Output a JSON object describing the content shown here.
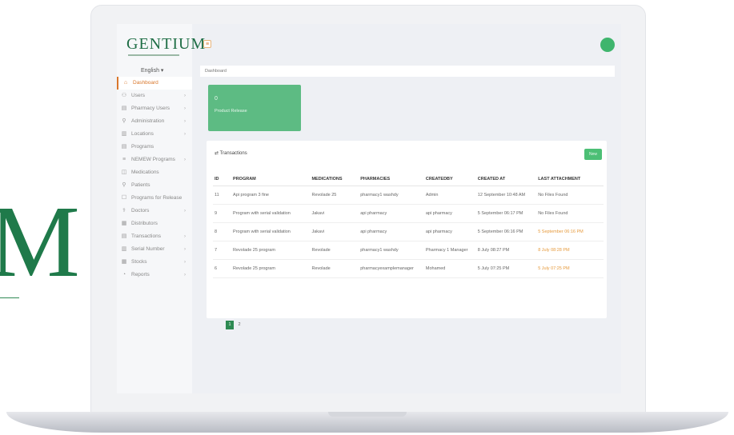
{
  "decor": {
    "letter": "M"
  },
  "sidebar": {
    "logo": "GENTIUM",
    "language": "English ▾",
    "items": [
      {
        "label": "Dashboard",
        "icon": "home-icon",
        "glyph": "⌂",
        "active": true
      },
      {
        "label": "Users",
        "icon": "user-icon",
        "glyph": "⚇",
        "chevron": "›"
      },
      {
        "label": "Pharmacy Users",
        "icon": "clipboard-icon",
        "glyph": "▤",
        "chevron": "›"
      },
      {
        "label": "Administration",
        "icon": "admin-icon",
        "glyph": "⚲",
        "chevron": "›"
      },
      {
        "label": "Locations",
        "icon": "location-icon",
        "glyph": "▥",
        "chevron": "›"
      },
      {
        "label": "Programs",
        "icon": "programs-icon",
        "glyph": "▤"
      },
      {
        "label": "NEMEW Programs",
        "icon": "list-icon",
        "glyph": "≡",
        "chevron": "›"
      },
      {
        "label": "Medications",
        "icon": "medication-icon",
        "glyph": "◫"
      },
      {
        "label": "Patients",
        "icon": "patient-icon",
        "glyph": "⚲"
      },
      {
        "label": "Programs for Release",
        "icon": "release-icon",
        "glyph": "☐"
      },
      {
        "label": "Doctors",
        "icon": "doctor-icon",
        "glyph": "⚕",
        "chevron": "›"
      },
      {
        "label": "Distributors",
        "icon": "distributor-icon",
        "glyph": "▦"
      },
      {
        "label": "Transactions",
        "icon": "transactions-icon",
        "glyph": "▤",
        "chevron": "›"
      },
      {
        "label": "Serial Number",
        "icon": "barcode-icon",
        "glyph": "▥",
        "chevron": "›"
      },
      {
        "label": "Stocks",
        "icon": "stocks-icon",
        "glyph": "▦",
        "chevron": "›"
      },
      {
        "label": "Reports",
        "icon": "reports-icon",
        "glyph": "◔",
        "chevron": "›"
      }
    ]
  },
  "topbar": {
    "menu_glyph": "≡"
  },
  "breadcrumb": "Dashboard",
  "product_card": {
    "number": "0",
    "label": "Product Release"
  },
  "transactions": {
    "title": "Transactions",
    "new_label": "New",
    "columns": [
      "ID",
      "PROGRAM",
      "MEDICATIONS",
      "PHARMACIES",
      "CREATEDBY",
      "CREATED AT",
      "LAST ATTACHMENT"
    ],
    "rows": [
      [
        "11",
        "Api program 3 fine",
        "Revolade 25",
        "pharmacy1 washdy",
        "Admin",
        "12 September 10:48 AM",
        "No Files Found"
      ],
      [
        "9",
        "Program with serial validation",
        "Jakavi",
        "api pharmacy",
        "api pharmacy",
        "5 September 06:17 PM",
        "No Files Found"
      ],
      [
        "8",
        "Program with serial validation",
        "Jakavi",
        "api pharmacy",
        "api pharmacy",
        "5 September 06:16 PM",
        "5 September 06:16 PM"
      ],
      [
        "7",
        "Revolade 25 program",
        "Revolade",
        "pharmacy1 washdy",
        "Pharmacy 1 Manager",
        "8 July 08:27 PM",
        "8 July 08:28 PM"
      ],
      [
        "6",
        "Revolade 25 program",
        "Revolade",
        "pharmacyexamplemanager",
        "Mohamed",
        "5 July 07:25 PM",
        "5 July 07:25 PM"
      ]
    ],
    "orange_attachment_rows": [
      2,
      3,
      4
    ]
  },
  "pagination": {
    "pages": [
      "1",
      "2"
    ],
    "active": "1"
  },
  "colors": {
    "brand_green": "#2d8a52",
    "accent_orange": "#d9772b",
    "card_green": "#5dbb83"
  }
}
